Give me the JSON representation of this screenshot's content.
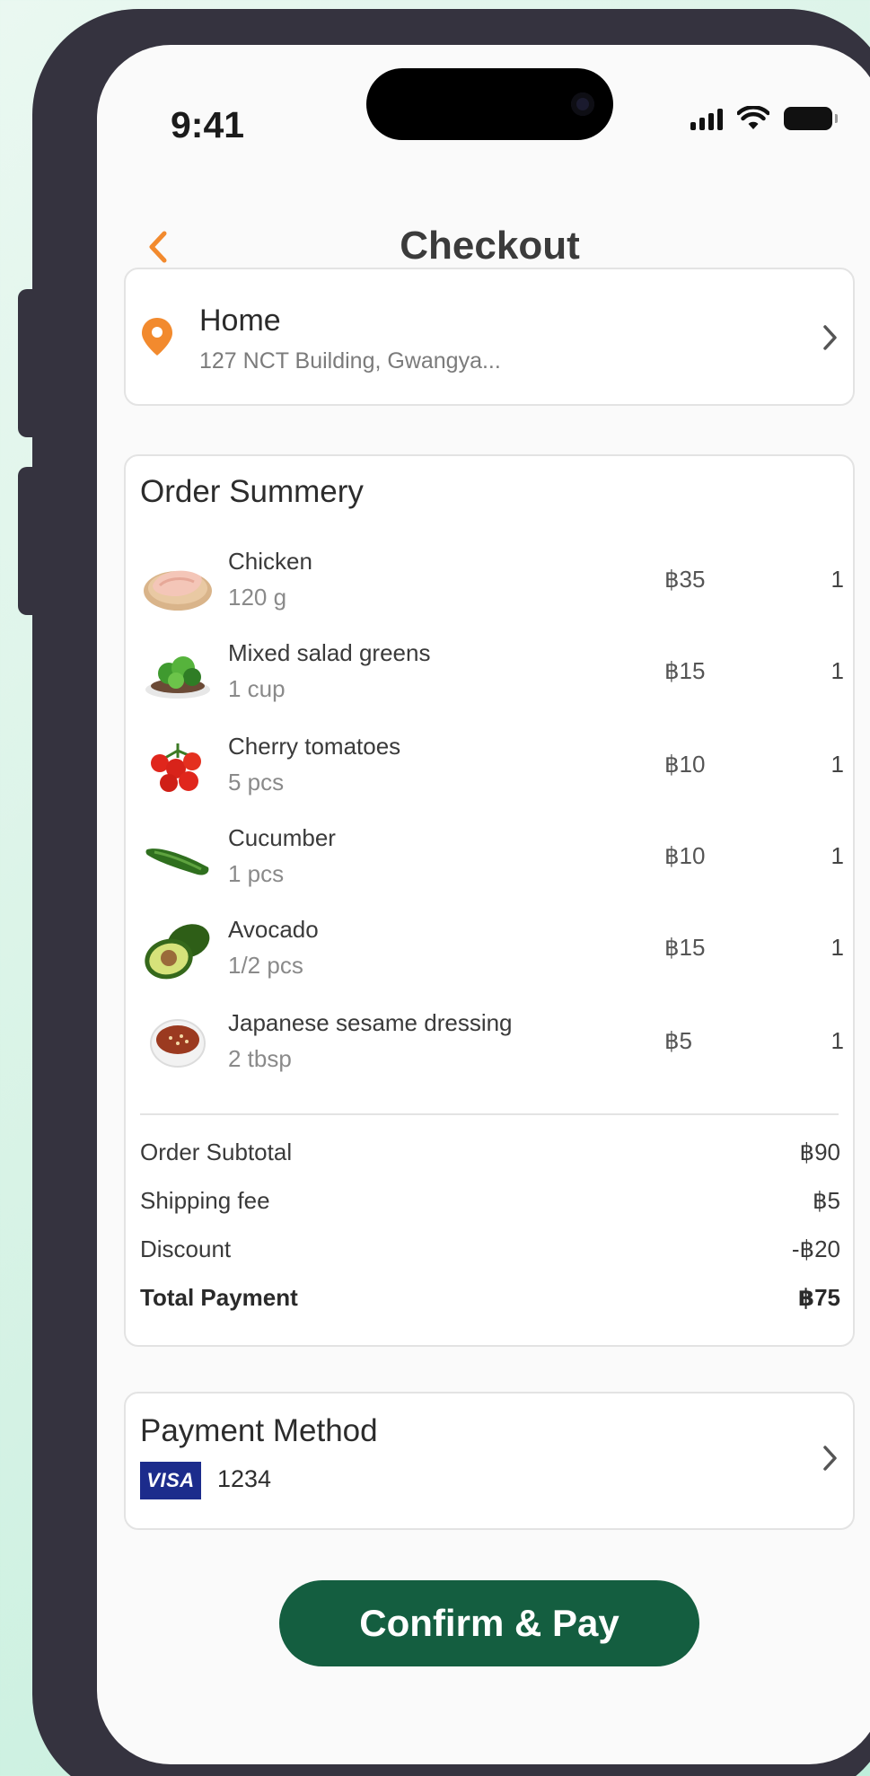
{
  "status_bar": {
    "time": "9:41"
  },
  "header": {
    "title": "Checkout"
  },
  "address": {
    "label": "Home",
    "detail": "127 NCT Building, Gwangya..."
  },
  "order_summary": {
    "title": "Order Summery",
    "items": [
      {
        "name": "Chicken",
        "quantity": "120 g",
        "price": "฿35",
        "count": "1",
        "icon": "chicken-breast-icon"
      },
      {
        "name": "Mixed salad greens",
        "quantity": "1 cup",
        "price": "฿15",
        "count": "1",
        "icon": "salad-greens-icon"
      },
      {
        "name": "Cherry tomatoes",
        "quantity": "5 pcs",
        "price": "฿10",
        "count": "1",
        "icon": "cherry-tomatoes-icon"
      },
      {
        "name": "Cucumber",
        "quantity": "1 pcs",
        "price": "฿10",
        "count": "1",
        "icon": "cucumber-icon"
      },
      {
        "name": "Avocado",
        "quantity": "1/2 pcs",
        "price": "฿15",
        "count": "1",
        "icon": "avocado-icon"
      },
      {
        "name": "Japanese sesame dressing",
        "quantity": "2 tbsp",
        "price": "฿5",
        "count": "1",
        "icon": "sesame-dressing-icon"
      }
    ],
    "totals": {
      "subtotal_label": "Order Subtotal",
      "subtotal_value": "฿90",
      "shipping_label": "Shipping fee",
      "shipping_value": "฿5",
      "discount_label": "Discount",
      "discount_value": "-฿20",
      "total_label": "Total Payment",
      "total_value": "฿75"
    }
  },
  "payment": {
    "title": "Payment Method",
    "card_brand": "VISA",
    "card_last4": "1234"
  },
  "confirm_button": "Confirm & Pay",
  "colors": {
    "accent": "#f28a2e",
    "primary_button": "#145e40",
    "visa_blue": "#1c2c8c",
    "frame": "#35333f"
  }
}
